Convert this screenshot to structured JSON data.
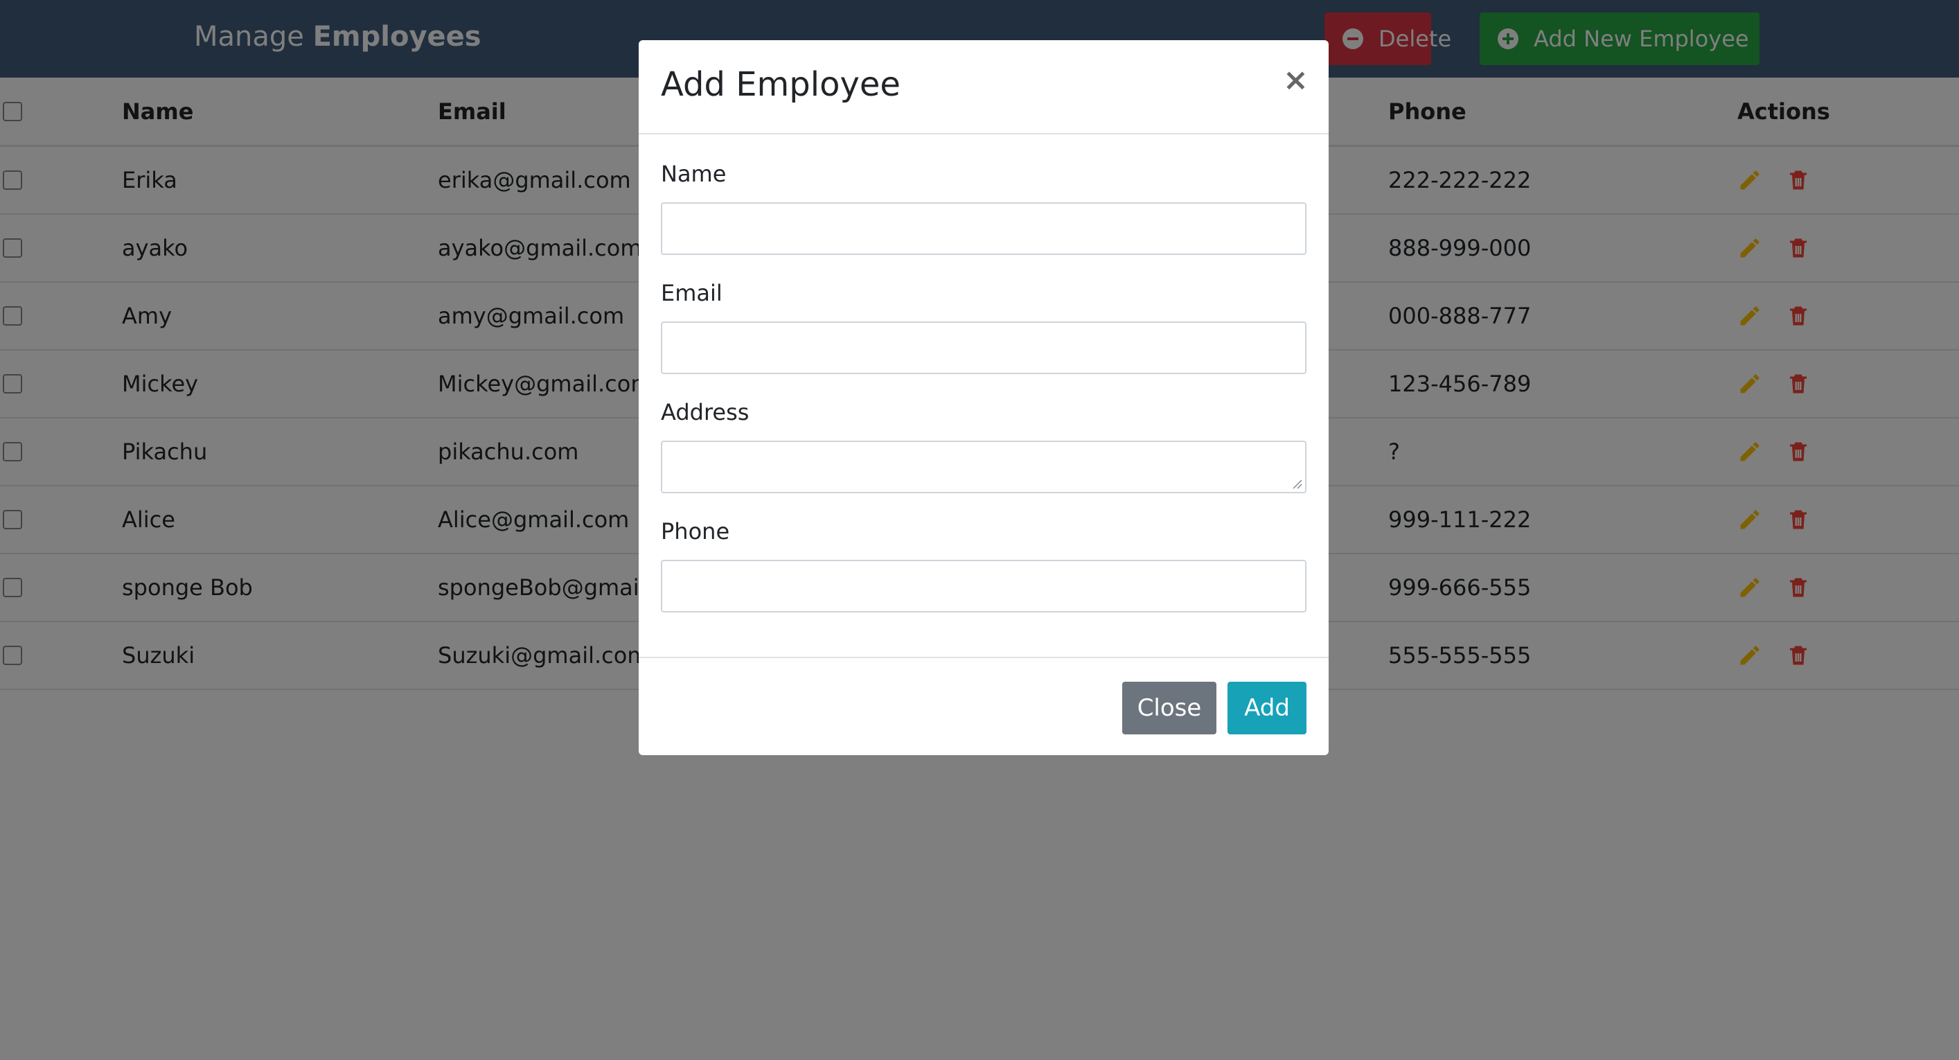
{
  "header": {
    "title_prefix": "Manage",
    "title_bold": "Employees",
    "delete_label": "Delete",
    "add_new_label": "Add New Employee"
  },
  "table": {
    "columns": {
      "name": "Name",
      "email": "Email",
      "phone": "Phone",
      "actions": "Actions"
    },
    "rows": [
      {
        "name": "Erika",
        "email": "erika@gmail.com",
        "phone": "222-222-222"
      },
      {
        "name": "ayako",
        "email": "ayako@gmail.com",
        "phone": "888-999-000"
      },
      {
        "name": "Amy",
        "email": "amy@gmail.com",
        "phone": "000-888-777"
      },
      {
        "name": "Mickey",
        "email": "Mickey@gmail.com",
        "phone": "123-456-789"
      },
      {
        "name": "Pikachu",
        "email": "pikachu.com",
        "phone": "?"
      },
      {
        "name": "Alice",
        "email": "Alice@gmail.com",
        "phone": "999-111-222"
      },
      {
        "name": "sponge Bob",
        "email": "spongeBob@gmail.com",
        "phone": "999-666-555"
      },
      {
        "name": "Suzuki",
        "email": "Suzuki@gmail.com",
        "phone": "555-555-555"
      }
    ]
  },
  "modal": {
    "title": "Add Employee",
    "close_x": "×",
    "fields": {
      "name_label": "Name",
      "name_value": "",
      "email_label": "Email",
      "email_value": "",
      "address_label": "Address",
      "address_value": "",
      "phone_label": "Phone",
      "phone_value": ""
    },
    "close_label": "Close",
    "add_label": "Add"
  },
  "colors": {
    "header_bg": "#435d7d",
    "delete": "#dc3545",
    "add_new": "#28a745",
    "edit_icon": "#ffc107",
    "delete_icon": "#f44336",
    "modal_close_btn": "#6c757d",
    "modal_add_btn": "#17a2b8"
  },
  "icons": {
    "delete_button": "minus-circle-icon",
    "add_new_button": "plus-circle-icon",
    "row_edit": "pencil-icon",
    "row_delete": "trash-icon"
  }
}
